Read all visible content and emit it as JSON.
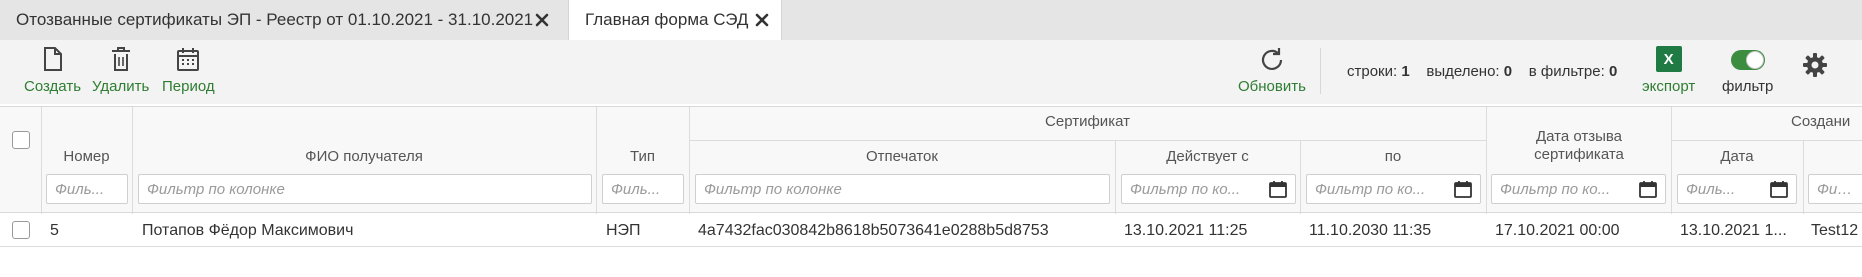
{
  "tabs": [
    {
      "label": "Отозванные сертификаты ЭП - Реестр от 01.10.2021 - 31.10.2021"
    },
    {
      "label": "Главная форма СЭД"
    }
  ],
  "toolbar": {
    "create_label": "Создать",
    "delete_label": "Удалить",
    "period_label": "Период",
    "refresh_label": "Обновить",
    "export_label": "экспорт",
    "export_icon_text": "X",
    "filter_label": "фильтр",
    "stats": {
      "rows_label": "строки:",
      "rows_value": "1",
      "selected_label": "выделено:",
      "selected_value": "0",
      "filtered_label": "в фильтре:",
      "filtered_value": "0"
    }
  },
  "grid": {
    "group_headers": {
      "certificate": "Сертификат",
      "created": "Создани"
    },
    "columns": {
      "number": "Номер",
      "fio": "ФИО получателя",
      "type": "Тип",
      "fingerprint": "Отпечаток",
      "valid_from": "Действует с",
      "valid_to": "по",
      "revoke_date": "Дата отзыва сертификата",
      "created_date": "Дата"
    },
    "filters": {
      "number": "Филь...",
      "fio": "Фильтр по колонке",
      "type": "Филь...",
      "fingerprint": "Фильтр по колонке",
      "valid_from": "Фильтр по ко...",
      "valid_to": "Фильтр по ко...",
      "revoke_date": "Фильтр по ко...",
      "created_date": "Филь...",
      "created_by": "Филь..."
    },
    "rows": [
      {
        "number": "5",
        "fio": "Потапов Фёдор Максимович",
        "type": "НЭП",
        "fingerprint": "4a7432fac030842b8618b5073641e0288b5d8753",
        "valid_from": "13.10.2021 11:25",
        "valid_to": "11.10.2030 11:35",
        "revoke_date": "17.10.2021 00:00",
        "created_date": "13.10.2021 1...",
        "created_by": "Test12"
      }
    ]
  },
  "colors": {
    "accent": "#2e7d32",
    "toggle_on": "#3d8d40",
    "excel": "#1f7a44"
  }
}
